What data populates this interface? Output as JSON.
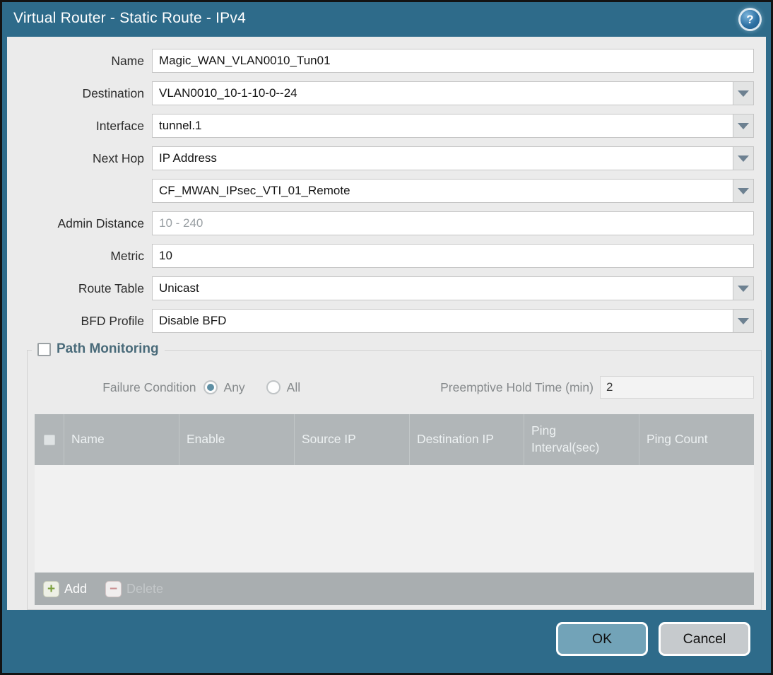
{
  "dialog": {
    "title": "Virtual Router - Static Route - IPv4",
    "help_icon": "?"
  },
  "form": {
    "name": {
      "label": "Name",
      "value": "Magic_WAN_VLAN0010_Tun01"
    },
    "destination": {
      "label": "Destination",
      "value": "VLAN0010_10-1-10-0--24"
    },
    "interface": {
      "label": "Interface",
      "value": "tunnel.1"
    },
    "next_hop": {
      "label": "Next Hop",
      "value": "IP Address"
    },
    "next_hop_address": {
      "value": "CF_MWAN_IPsec_VTI_01_Remote"
    },
    "admin_distance": {
      "label": "Admin Distance",
      "value": "",
      "placeholder": "10 - 240"
    },
    "metric": {
      "label": "Metric",
      "value": "10"
    },
    "route_table": {
      "label": "Route Table",
      "value": "Unicast"
    },
    "bfd_profile": {
      "label": "BFD Profile",
      "value": "Disable BFD"
    }
  },
  "path_monitoring": {
    "title": "Path Monitoring",
    "checked": false,
    "failure_condition": {
      "label": "Failure Condition",
      "options": [
        {
          "label": "Any",
          "selected": true
        },
        {
          "label": "All",
          "selected": false
        }
      ]
    },
    "preemptive_hold_time": {
      "label": "Preemptive Hold Time (min)",
      "value": "2"
    },
    "table": {
      "columns": [
        "Name",
        "Enable",
        "Source IP",
        "Destination IP",
        "Ping Interval(sec)",
        "Ping Count"
      ],
      "rows": []
    },
    "actions": {
      "add": "Add",
      "delete": "Delete"
    }
  },
  "footer": {
    "ok": "OK",
    "cancel": "Cancel"
  },
  "colors": {
    "titlebar": "#2e6b8a",
    "content_bg": "#ebebeb",
    "ok_button": "#72a3b8",
    "cancel_button": "#c6cacd",
    "table_header": "#b1b6b8",
    "radio_selected": "#5e8fa4",
    "add_icon_green": "#7a9e3b",
    "delete_icon_red": "#c98f91"
  }
}
